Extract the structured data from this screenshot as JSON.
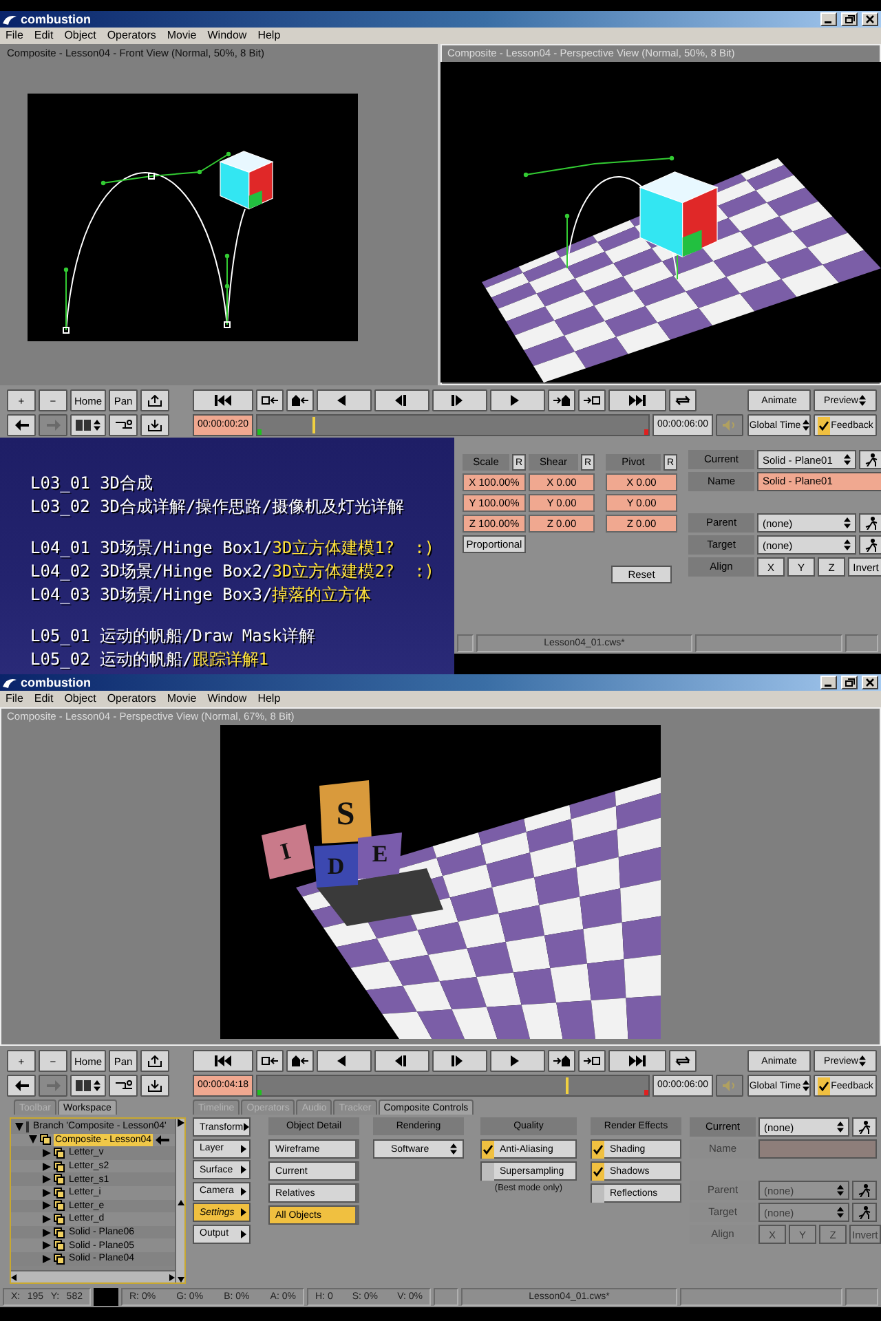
{
  "windows": [
    {
      "kind": "transform",
      "title": "combustion",
      "menu": [
        "File",
        "Edit",
        "Object",
        "Operators",
        "Movie",
        "Window",
        "Help"
      ],
      "viewports": [
        {
          "kind": "front",
          "header": "Composite - Lesson04 - Front View (Normal, 50%, 8 Bit)",
          "selected": false
        },
        {
          "kind": "perspective",
          "header": "Composite - Lesson04 - Perspective View (Normal, 50%, 8 Bit)",
          "selected": true
        }
      ],
      "toolbar": {
        "tools": [
          "+",
          "−",
          "Home",
          "Pan"
        ],
        "forward_disabled": true,
        "current_time": "00:00:00:20",
        "level": 0.14,
        "end_time": "00:00:06:00",
        "animate": "Animate",
        "preview": "Preview",
        "time_mode": "Global Time",
        "feedback": {
          "label": "Feedback",
          "checked": true
        }
      },
      "course_menu": {
        "groups": [
          [
            {
              "parts": [
                {
                  "text": "L03_01 3D合成",
                  "highlight": false
                }
              ]
            },
            {
              "parts": [
                {
                  "text": "L03_02 3D合成详解/操作思路/摄像机及灯光详解",
                  "highlight": false
                }
              ]
            }
          ],
          [
            {
              "parts": [
                {
                  "text": "L04_01 3D场景/Hinge Box1/",
                  "highlight": false
                },
                {
                  "text": "3D立方体建模1?  :)",
                  "highlight": true
                }
              ]
            },
            {
              "parts": [
                {
                  "text": "L04_02 3D场景/Hinge Box2/",
                  "highlight": false
                },
                {
                  "text": "3D立方体建模2?  :)",
                  "highlight": true
                }
              ]
            },
            {
              "parts": [
                {
                  "text": "L04_03 3D场景/Hinge Box3/",
                  "highlight": false
                },
                {
                  "text": "掉落的立方体",
                  "highlight": true
                }
              ]
            }
          ],
          [
            {
              "parts": [
                {
                  "text": "L05_01 运动的帆船/Draw Mask详解",
                  "highlight": false
                }
              ]
            },
            {
              "parts": [
                {
                  "text": "L05_02 运动的帆船/",
                  "highlight": false
                },
                {
                  "text": "跟踪详解1",
                  "highlight": true
                }
              ]
            }
          ]
        ]
      },
      "panel": {
        "columns": [
          {
            "title": "Scale",
            "reset": "R",
            "fields": [
              "X 100.00%",
              "Y 100.00%",
              "Z 100.00%"
            ],
            "button": {
              "kind": "toggle",
              "label": "Proportional"
            }
          },
          {
            "title": "Shear",
            "reset": "R",
            "fields": [
              "X 0.00",
              "Y 0.00",
              "Z 0.00"
            ]
          },
          {
            "title": "Pivot",
            "reset": "R",
            "fields": [
              "X 0.00",
              "Y 0.00",
              "Z 0.00"
            ],
            "button": {
              "kind": "action",
              "label": "Reset"
            }
          }
        ],
        "properties": {
          "rows": [
            {
              "kind": "select",
              "label": "Current",
              "value": "Solid - Plane01",
              "disabled": false
            },
            {
              "kind": "text",
              "label": "Name",
              "value": "Solid - Plane01",
              "disabled": false
            },
            {
              "kind": "select",
              "label": "Parent",
              "value": "(none)",
              "disabled": false
            },
            {
              "kind": "select",
              "label": "Target",
              "value": "(none)",
              "disabled": false
            },
            {
              "kind": "align",
              "label": "Align",
              "buttons": [
                "X",
                "Y",
                "Z",
                "Invert"
              ],
              "disabled": false
            }
          ]
        }
      },
      "status_bar": {
        "file": "Lesson04_01.cws*"
      }
    },
    {
      "kind": "composite",
      "title": "combustion",
      "menu": [
        "File",
        "Edit",
        "Object",
        "Operators",
        "Movie",
        "Window",
        "Help"
      ],
      "viewports": [
        {
          "kind": "render",
          "header": "Composite - Lesson04 - Perspective View (Normal, 67%, 8 Bit)",
          "selected": true,
          "letters": [
            "S",
            "I",
            "D",
            "E"
          ]
        }
      ],
      "toolbar": {
        "tools": [
          "+",
          "−",
          "Home",
          "Pan"
        ],
        "forward_disabled": true,
        "current_time": "00:00:04:18",
        "level": 0.79,
        "end_time": "00:00:06:00",
        "animate": "Animate",
        "preview": "Preview",
        "time_mode": "Global Time",
        "feedback": {
          "label": "Feedback",
          "checked": true
        }
      },
      "panel": {
        "tabs_left": [
          {
            "label": "Toolbar",
            "selected": false
          },
          {
            "label": "Workspace",
            "selected": true
          }
        ],
        "tabs_right": [
          {
            "label": "Timeline",
            "selected": false
          },
          {
            "label": "Operators",
            "selected": false
          },
          {
            "label": "Audio",
            "selected": false
          },
          {
            "label": "Tracker",
            "selected": false
          },
          {
            "label": "Composite Controls",
            "selected": true
          }
        ],
        "tree": [
          {
            "kind": "branch",
            "label": "Branch 'Composite - Lesson04'",
            "expanded": true,
            "selected": false,
            "children": [
              {
                "kind": "layer",
                "label": "Composite - Lesson04",
                "expanded": true,
                "selected": true,
                "children": [
                  {
                    "kind": "layer",
                    "label": "Letter_v",
                    "expanded": false,
                    "selected": false
                  },
                  {
                    "kind": "layer",
                    "label": "Letter_s2",
                    "expanded": false,
                    "selected": false
                  },
                  {
                    "kind": "layer",
                    "label": "Letter_s1",
                    "expanded": false,
                    "selected": false
                  },
                  {
                    "kind": "layer",
                    "label": "Letter_i",
                    "expanded": false,
                    "selected": false
                  },
                  {
                    "kind": "layer",
                    "label": "Letter_e",
                    "expanded": false,
                    "selected": false
                  },
                  {
                    "kind": "layer",
                    "label": "Letter_d",
                    "expanded": false,
                    "selected": false
                  },
                  {
                    "kind": "layer",
                    "label": "Solid - Plane06",
                    "expanded": false,
                    "selected": false
                  },
                  {
                    "kind": "layer",
                    "label": "Solid - Plane05",
                    "expanded": false,
                    "selected": false
                  },
                  {
                    "kind": "layer",
                    "label": "Solid - Plane04",
                    "expanded": false,
                    "selected": false
                  }
                ]
              }
            ]
          }
        ],
        "categories": [
          {
            "label": "Transform",
            "selected": false
          },
          {
            "label": "Layer",
            "selected": false
          },
          {
            "label": "Surface",
            "selected": false
          },
          {
            "label": "Camera",
            "selected": false
          },
          {
            "label": "Settings",
            "selected": true
          },
          {
            "label": "Output",
            "selected": false
          }
        ],
        "object_detail": {
          "title": "Object Detail",
          "options": [
            {
              "label": "Wireframe",
              "selected": false
            },
            {
              "label": "Current",
              "selected": false
            },
            {
              "label": "Relatives",
              "selected": false
            },
            {
              "label": "All Objects",
              "selected": true
            }
          ]
        },
        "rendering": {
          "title": "Rendering",
          "value": "Software"
        },
        "quality": {
          "title": "Quality",
          "options": [
            {
              "label": "Anti-Aliasing",
              "checked": true
            },
            {
              "label": "Supersampling",
              "checked": false
            }
          ],
          "note": "(Best mode only)"
        },
        "render_effects": {
          "title": "Render Effects",
          "options": [
            {
              "label": "Shading",
              "checked": true
            },
            {
              "label": "Shadows",
              "checked": true
            },
            {
              "label": "Reflections",
              "checked": false
            }
          ]
        },
        "properties": {
          "rows": [
            {
              "kind": "select",
              "label": "Current",
              "value": "(none)",
              "disabled": false
            },
            {
              "kind": "text",
              "label": "Name",
              "disabled": true
            },
            {
              "kind": "select",
              "label": "Parent",
              "value": "(none)",
              "disabled": true
            },
            {
              "kind": "select",
              "label": "Target",
              "value": "(none)",
              "disabled": true
            },
            {
              "kind": "align",
              "label": "Align",
              "buttons": [
                "X",
                "Y",
                "Z",
                "Invert"
              ],
              "disabled": true
            }
          ]
        }
      },
      "status_bar": {
        "groups": [
          [
            "X:",
            "195",
            "Y:",
            "582"
          ],
          [
            "R: 0%",
            "G: 0%",
            "B: 0%",
            "A: 0%"
          ],
          [
            "H: 0",
            "S: 0%",
            "V: 0%"
          ]
        ],
        "file": "Lesson04_01.cws*"
      }
    }
  ]
}
